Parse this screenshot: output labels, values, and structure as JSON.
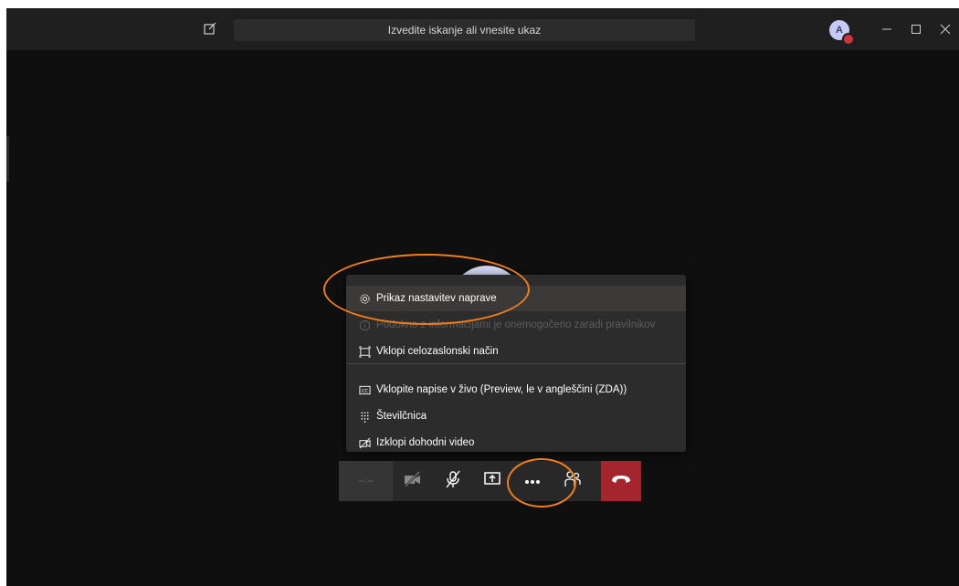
{
  "titlebar": {
    "search_placeholder": "Izvedite iskanje ali vnesite ukaz",
    "avatar_initial": "A",
    "window_controls": [
      "minimize-icon",
      "maximize-icon",
      "close-icon"
    ]
  },
  "menu": {
    "items": [
      {
        "label": "Prikaz nastavitev naprave",
        "icon": "gear-icon",
        "state": "highlighted"
      },
      {
        "label": "Podokno z informacijami je onemogočeno zaradi pravilnikov",
        "icon": "info-icon",
        "state": "disabled"
      },
      {
        "label": "Vklopi celozaslonski način",
        "icon": "fullscreen-icon",
        "state": "normal"
      },
      {
        "label": "Vklopite napise v živo (Preview, le v angleščini (ZDA))",
        "icon": "captions-icon",
        "state": "normal"
      },
      {
        "label": "Številčnica",
        "icon": "dialpad-icon",
        "state": "normal"
      },
      {
        "label": "Izklopi dohodni video",
        "icon": "video-off-icon",
        "state": "normal"
      }
    ]
  },
  "toolbar": {
    "timer": "--:--",
    "buttons": [
      "camera-off-icon",
      "mic-off-icon",
      "share-screen-icon",
      "more-options-icon",
      "participants-icon",
      "hang-up-icon"
    ]
  },
  "colors": {
    "background": "#0f0f0f",
    "titlebar": "#1f1f1f",
    "menu_bg": "#2d2c2c",
    "hangup": "#a4262c",
    "annotation": "#f07d1a"
  }
}
